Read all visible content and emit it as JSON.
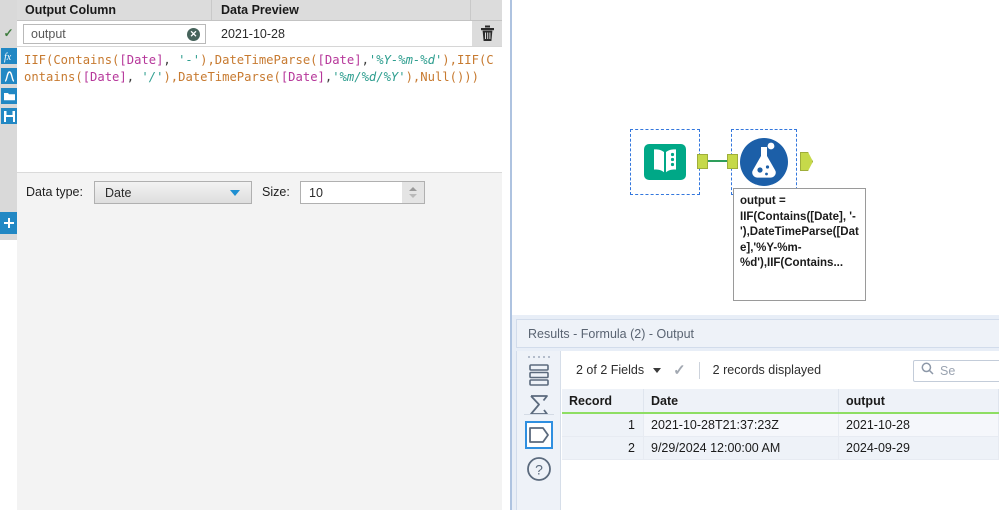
{
  "config_panel": {
    "columns": {
      "output_column": "Output Column",
      "data_preview": "Data Preview"
    },
    "field": {
      "name": "output",
      "preview_value": "2021-10-28",
      "clear_icon": "clear-circle-icon",
      "delete_icon": "trash-icon",
      "valid_icon": "checkmark-icon"
    },
    "formula": {
      "full_text": "IIF(Contains([Date], '-'),DateTimeParse([Date],'%Y-%m-%d'),IIF(Contains([Date], '/'),DateTimeParse([Date],'%m/%d/%Y'),Null()))",
      "tokens": [
        {
          "t": "IIF(Contains(",
          "c": "fn"
        },
        {
          "t": "[Date]",
          "c": "fld"
        },
        {
          "t": ", ",
          "c": "punc"
        },
        {
          "t": "'-'",
          "c": "str"
        },
        {
          "t": "),DateTimeParse(",
          "c": "fn"
        },
        {
          "t": "[Date]",
          "c": "fld"
        },
        {
          "t": ",",
          "c": "punc"
        },
        {
          "t": "'%Y-%m-%d'",
          "c": "str"
        },
        {
          "t": "),IIF(Contains(",
          "c": "fn"
        },
        {
          "t": "[Date]",
          "c": "fld"
        },
        {
          "t": ", ",
          "c": "punc"
        },
        {
          "t": "'/'",
          "c": "str"
        },
        {
          "t": "),DateTimeParse(",
          "c": "fn"
        },
        {
          "t": "[Date]",
          "c": "fld"
        },
        {
          "t": ",",
          "c": "punc"
        },
        {
          "t": "'%m/%d/%Y'",
          "c": "str"
        },
        {
          "t": "),Null()))",
          "c": "fn"
        }
      ]
    },
    "data_type": {
      "label": "Data type:",
      "value": "Date",
      "size_label": "Size:",
      "size_value": "10"
    },
    "rail_icons": [
      "fx-icon",
      "function-curve-icon",
      "open-folder-icon",
      "save-disk-icon"
    ],
    "add_button_icon": "plus-icon"
  },
  "canvas": {
    "nodes": [
      {
        "name": "text-input-tool",
        "icon": "open-book-icon",
        "color": "#00a887"
      },
      {
        "name": "formula-tool",
        "icon": "flask-icon",
        "color": "#1c5fa8"
      }
    ],
    "annotation": "output = IIF(Contains([Date], '-'),DateTimeParse([Date],'%Y-%m-%d'),IIF(Contains..."
  },
  "results": {
    "title": "Results - Formula (2) - Output",
    "toolbar": {
      "fields_label": "2 of 2 Fields",
      "records_label": "2 records displayed",
      "search_placeholder": "Se",
      "search_icon": "search-icon",
      "check_icon": "checkmark-icon",
      "caret_icon": "chevron-down-icon"
    },
    "rail_icons": [
      "table-rows-icon",
      "sigma-summary-icon",
      "data-shape-icon",
      "help-question-icon"
    ],
    "grid": {
      "headers": [
        "Record",
        "Date",
        "output"
      ],
      "rows": [
        {
          "record": "1",
          "date": "2021-10-28T21:37:23Z",
          "output": "2021-10-28"
        },
        {
          "record": "2",
          "date": "9/29/2024 12:00:00 AM",
          "output": "2024-09-29"
        }
      ]
    }
  },
  "colors": {
    "accent_blue": "#2288c4",
    "node_green": "#00a887",
    "node_blue": "#1c5fa8",
    "port_green": "#c6d94a",
    "header_underline": "#8ede63"
  }
}
